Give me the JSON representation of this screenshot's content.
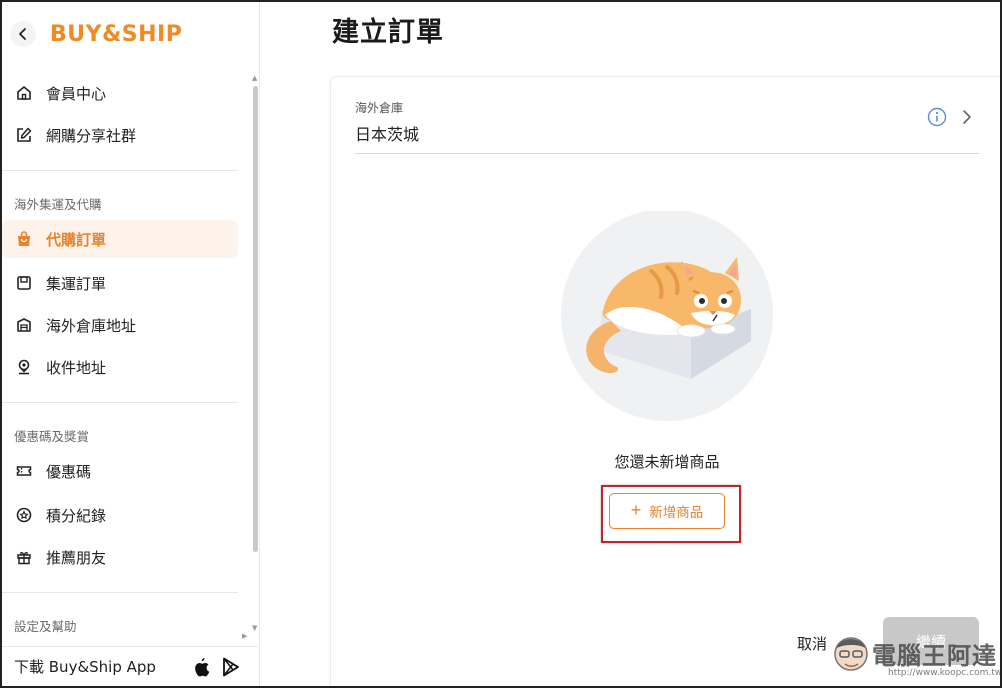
{
  "brand": {
    "logo_text": "BUY&SHIP",
    "accent_color": "#e9822a",
    "highlight_color": "#c0262d"
  },
  "sidebar": {
    "top_items": [
      {
        "label": "會員中心",
        "icon": "home-icon"
      },
      {
        "label": "網購分享社群",
        "icon": "edit-icon"
      }
    ],
    "sections": [
      {
        "title": "海外集運及代購",
        "items": [
          {
            "label": "代購訂單",
            "icon": "shopping-bag-icon",
            "active": true
          },
          {
            "label": "集運訂單",
            "icon": "box-icon"
          },
          {
            "label": "海外倉庫地址",
            "icon": "warehouse-icon"
          },
          {
            "label": "收件地址",
            "icon": "location-pin-icon"
          }
        ]
      },
      {
        "title": "優惠碼及獎賞",
        "items": [
          {
            "label": "優惠碼",
            "icon": "coupon-icon"
          },
          {
            "label": "積分紀錄",
            "icon": "points-icon"
          },
          {
            "label": "推薦朋友",
            "icon": "gift-icon"
          }
        ]
      },
      {
        "title": "設定及幫助",
        "items": []
      }
    ],
    "app_download": "下載 Buy&Ship App"
  },
  "main": {
    "page_title": "建立訂單",
    "warehouse": {
      "label": "海外倉庫",
      "value": "日本茨城"
    },
    "empty_message": "您還未新增商品",
    "add_button": "新增商品",
    "cancel_button": "取消",
    "continue_button": "繼續"
  },
  "watermark": {
    "text": "電腦王阿達",
    "url": "http://www.koopc.com.tw"
  }
}
